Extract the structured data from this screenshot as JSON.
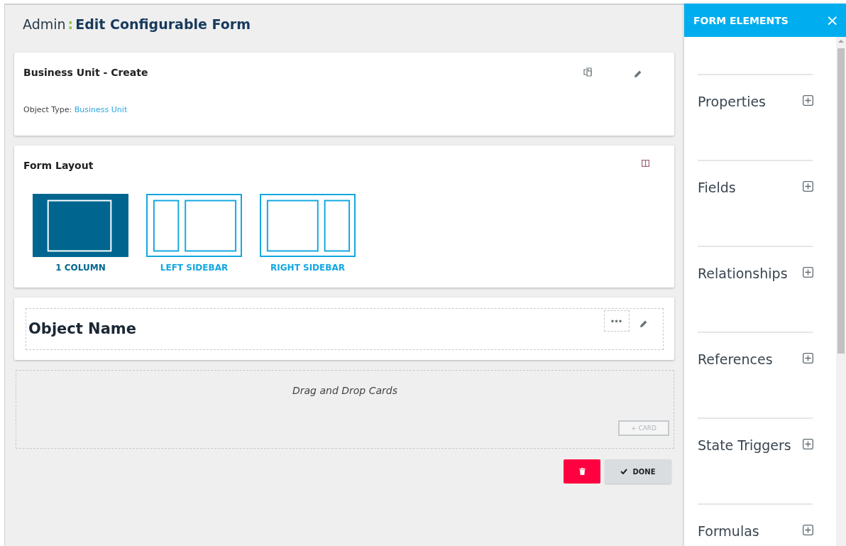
{
  "header": {
    "breadcrumb": "Admin",
    "separator": ":",
    "title": "Edit Configurable Form"
  },
  "form_card": {
    "title": "Business Unit - Create",
    "object_type_label": "Object Type:",
    "object_type_link": "Business Unit"
  },
  "layout_card": {
    "title": "Form Layout",
    "options": [
      {
        "kind": "one-column",
        "label": "1 COLUMN",
        "selected": true
      },
      {
        "kind": "left-sidebar",
        "label": "LEFT SIDEBAR",
        "selected": false
      },
      {
        "kind": "right-sidebar",
        "label": "RIGHT SIDEBAR",
        "selected": false
      }
    ]
  },
  "object_card": {
    "title": "Object Name",
    "menu": "•••"
  },
  "drop_zone": {
    "hint": "Drag and Drop Cards",
    "add_button": "+ CARD"
  },
  "actions": {
    "done": "DONE"
  },
  "panel": {
    "title": "FORM ELEMENTS",
    "close": "×",
    "sections": [
      {
        "label": "Properties",
        "expanded": false
      },
      {
        "label": "Fields",
        "expanded": false
      },
      {
        "label": "Relationships",
        "expanded": false
      },
      {
        "label": "References",
        "expanded": false
      },
      {
        "label": "State Triggers",
        "expanded": false
      },
      {
        "label": "Formulas",
        "expanded": false
      }
    ]
  }
}
